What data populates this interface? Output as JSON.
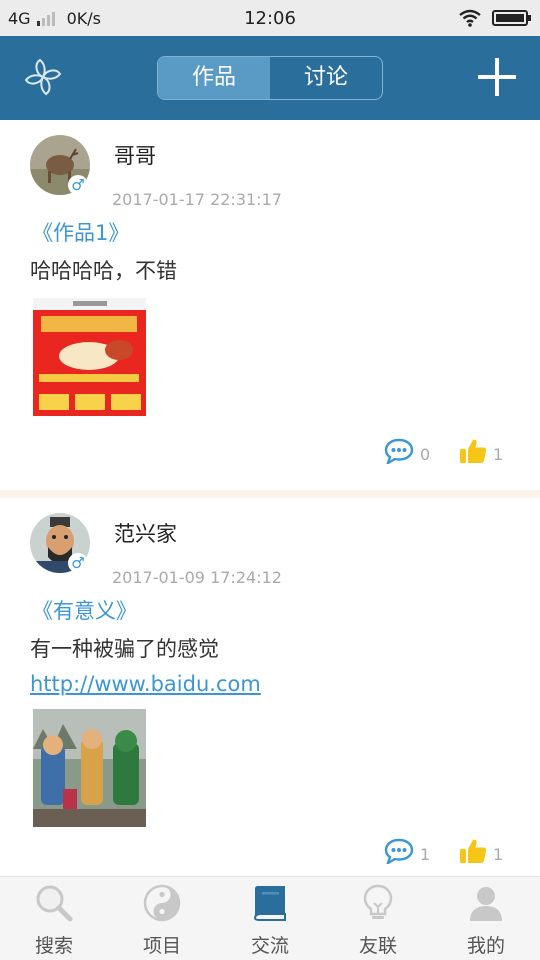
{
  "status_bar": {
    "network": "4G",
    "speed": "0K/s",
    "time": "12:06"
  },
  "header": {
    "tabs": [
      "作品",
      "讨论"
    ],
    "active_tab": 0
  },
  "posts": [
    {
      "username": "哥哥",
      "gender": "♂",
      "timestamp": "2017-01-17 22:31:17",
      "title": "《作品1》",
      "text": "哈哈哈哈，不错",
      "link": "",
      "comments": "0",
      "likes": "1"
    },
    {
      "username": "范兴家",
      "gender": "♂",
      "timestamp": "2017-01-09 17:24:12",
      "title": "《有意义》",
      "text": "有一种被骗了的感觉",
      "link": "http://www.baidu.com",
      "comments": "1",
      "likes": "1"
    }
  ],
  "tabbar": {
    "items": [
      {
        "label": "搜索",
        "icon": "search-icon"
      },
      {
        "label": "项目",
        "icon": "yin-yang-icon"
      },
      {
        "label": "交流",
        "icon": "book-icon"
      },
      {
        "label": "友联",
        "icon": "lightbulb-icon"
      },
      {
        "label": "我的",
        "icon": "person-icon"
      }
    ],
    "active_index": 2
  },
  "colors": {
    "header": "#2a6f9b",
    "accent": "#3b97d3",
    "like": "#f5c518"
  }
}
